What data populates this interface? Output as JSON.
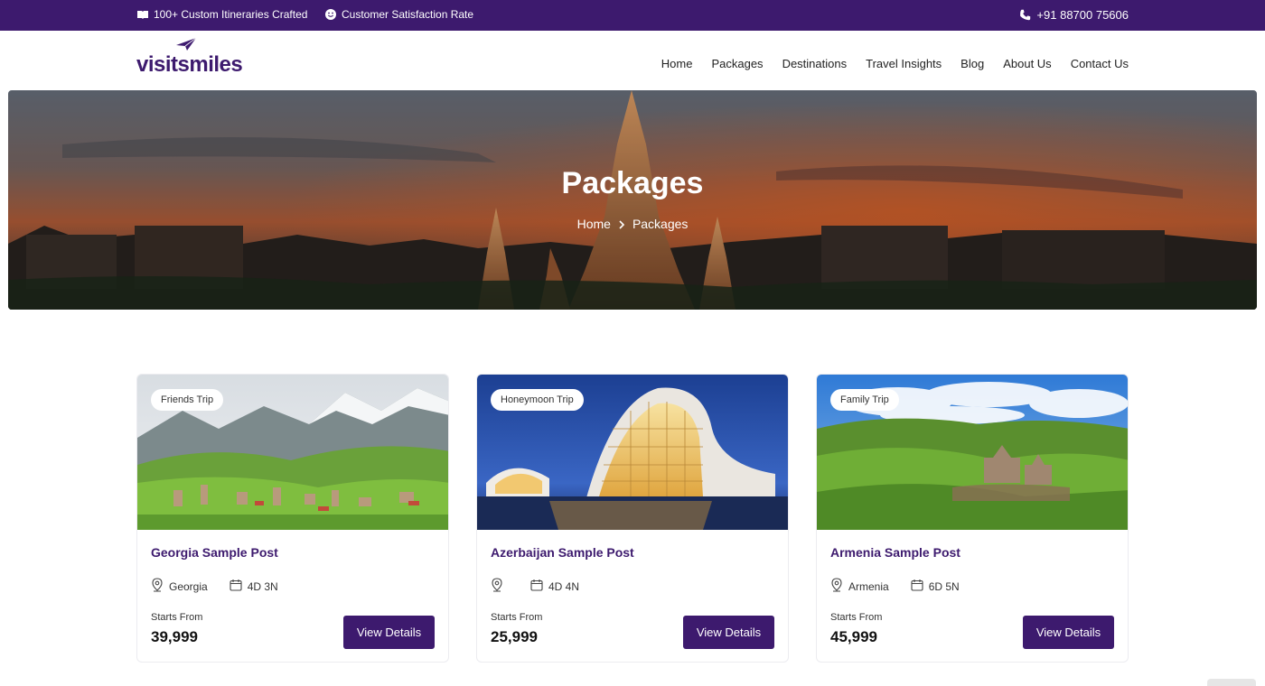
{
  "topbar": {
    "itineraries": "100+ Custom Itineraries Crafted",
    "satisfaction": "Customer Satisfaction Rate",
    "phone": "+91 88700 75606",
    "bg_color": "#3d1a6e"
  },
  "header": {
    "logo_text": "visitsmiles",
    "nav": [
      "Home",
      "Packages",
      "Destinations",
      "Travel Insights",
      "Blog",
      "About Us",
      "Contact Us"
    ]
  },
  "hero": {
    "title": "Packages",
    "breadcrumb": [
      "Home",
      "Packages"
    ]
  },
  "cards": [
    {
      "tag": "Friends Trip",
      "title": "Georgia Sample Post",
      "location": "Georgia",
      "duration": "4D 3N",
      "starts_label": "Starts From",
      "price": "39,999",
      "button": "View Details"
    },
    {
      "tag": "Honeymoon Trip",
      "title": "Azerbaijan Sample Post",
      "location": "",
      "duration": "4D 4N",
      "starts_label": "Starts From",
      "price": "25,999",
      "button": "View Details"
    },
    {
      "tag": "Family Trip",
      "title": "Armenia Sample Post",
      "location": "Armenia",
      "duration": "6D 5N",
      "starts_label": "Starts From",
      "price": "45,999",
      "button": "View Details"
    }
  ],
  "icons": {
    "itineraries": "book-icon",
    "satisfaction": "smile-icon",
    "phone": "phone-icon",
    "location": "map-pin-icon",
    "duration": "calendar-icon",
    "breadcrumb_sep": "chevron-right-icon"
  },
  "colors": {
    "brand": "#3d1a6e",
    "button": "#3d1a6e"
  }
}
